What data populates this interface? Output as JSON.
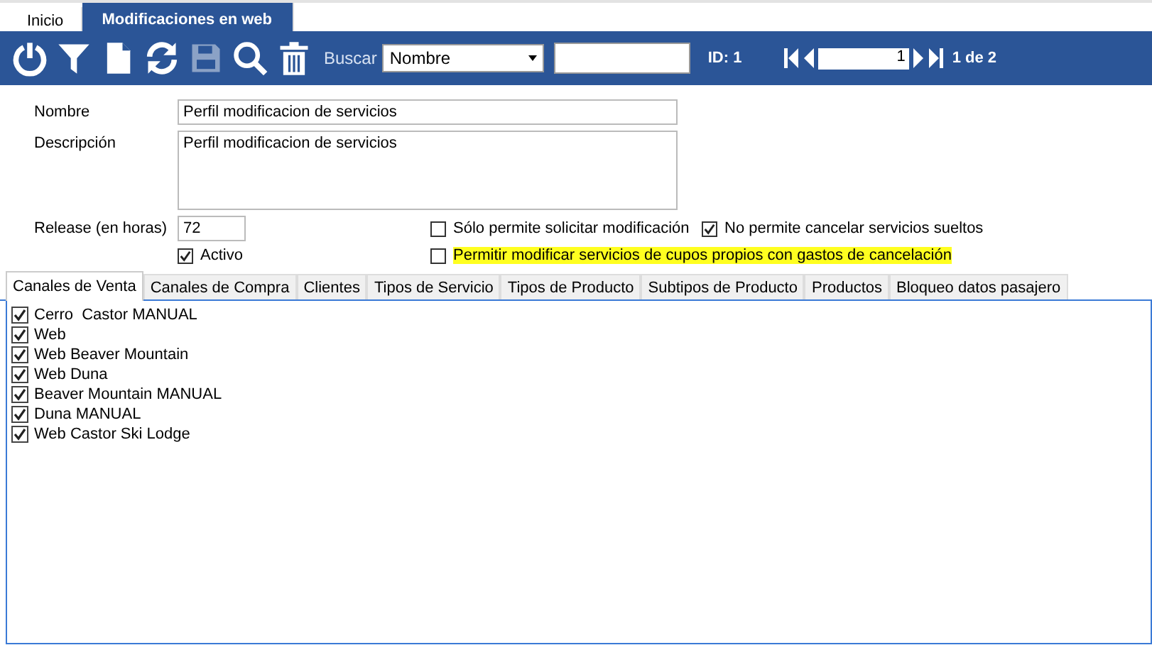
{
  "window_tabs": [
    {
      "label": "Inicio",
      "selected": false
    },
    {
      "label": "Modificaciones en web",
      "selected": true
    }
  ],
  "toolbar": {
    "buttons": [
      {
        "kind": "power",
        "disabled": false
      },
      {
        "kind": "filter",
        "disabled": false
      },
      {
        "kind": "new",
        "disabled": false
      },
      {
        "kind": "refresh",
        "disabled": false
      },
      {
        "kind": "save",
        "disabled": true
      },
      {
        "kind": "search",
        "disabled": false
      },
      {
        "kind": "delete",
        "disabled": false
      }
    ],
    "search_label": "Buscar",
    "search_field": "Nombre",
    "id_label": "ID: 1",
    "page_value": "1",
    "page_count": "1 de 2"
  },
  "form": {
    "name_label": "Nombre",
    "name_value": "Perfil modificacion de servicios",
    "description_label": "Descripción",
    "description_value": "Perfil modificacion de servicios",
    "release_label": "Release (en horas)",
    "release_value": "72",
    "checkboxes": [
      {
        "label": "Sólo permite solicitar modificación",
        "checked": false,
        "highlighted": false
      },
      {
        "label": "No permite cancelar servicios sueltos",
        "checked": true,
        "highlighted": false
      },
      {
        "label": "Activo",
        "checked": true,
        "highlighted": false
      },
      {
        "label": "Permitir modificar servicios de cupos propios con gastos de cancelación",
        "checked": false,
        "highlighted": true
      }
    ]
  },
  "section_tabs": [
    {
      "label": "Canales de Venta",
      "selected": true
    },
    {
      "label": "Canales de Compra",
      "selected": false
    },
    {
      "label": "Clientes",
      "selected": false
    },
    {
      "label": "Tipos de Servicio",
      "selected": false
    },
    {
      "label": "Tipos de Producto",
      "selected": false
    },
    {
      "label": "Subtipos de Producto",
      "selected": false
    },
    {
      "label": "Productos",
      "selected": false
    },
    {
      "label": "Bloqueo datos pasajero",
      "selected": false
    }
  ],
  "channels": [
    {
      "label": "Cerro  Castor MANUAL",
      "checked": true
    },
    {
      "label": "Web",
      "checked": true
    },
    {
      "label": "Web Beaver Mountain",
      "checked": true
    },
    {
      "label": "Web Duna",
      "checked": true
    },
    {
      "label": "Beaver Mountain MANUAL",
      "checked": true
    },
    {
      "label": "Duna MANUAL",
      "checked": true
    },
    {
      "label": "Web Castor Ski Lodge",
      "checked": true
    }
  ]
}
